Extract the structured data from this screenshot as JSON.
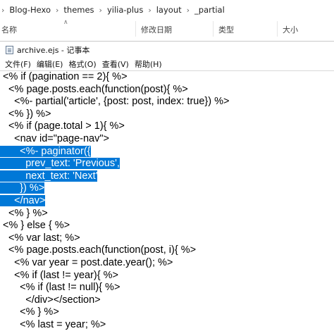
{
  "breadcrumb": {
    "items": [
      "Blog-Hexo",
      "themes",
      "yilia-plus",
      "layout",
      "_partial"
    ]
  },
  "columns": {
    "name": "名称",
    "modified": "修改日期",
    "type": "类型",
    "size": "大小"
  },
  "notepad": {
    "title": "archive.ejs - 记事本",
    "menus": [
      "文件(F)",
      "编辑(E)",
      "格式(O)",
      "查看(V)",
      "帮助(H)"
    ],
    "selection_color": "#0078d7",
    "lines": [
      {
        "text": "<% if (pagination == 2){ %>"
      },
      {
        "text": "  <% page.posts.each(function(post){ %>"
      },
      {
        "text": "    <%- partial('article', {post: post, index: true}) %>"
      },
      {
        "text": "  <% }) %>"
      },
      {
        "text": "  <% if (page.total > 1){ %>"
      },
      {
        "text": "    <nav id=\"page-nav\">"
      },
      {
        "text": "      <%- paginator({",
        "selected": true
      },
      {
        "text": "        prev_text: 'Previous',",
        "selected": true
      },
      {
        "text": "        next_text: 'Next'",
        "selected": true
      },
      {
        "text": "      }) %>",
        "selected": true
      },
      {
        "text": "    </nav>",
        "selected": true
      },
      {
        "text": "  <% } %>"
      },
      {
        "text": "<% } else { %>"
      },
      {
        "text": "  <% var last; %>"
      },
      {
        "text": "  <% page.posts.each(function(post, i){ %>"
      },
      {
        "text": "    <% var year = post.date.year(); %>"
      },
      {
        "text": "    <% if (last != year){ %>"
      },
      {
        "text": "      <% if (last != null){ %>"
      },
      {
        "text": "        </div></section>"
      },
      {
        "text": "      <% } %>"
      },
      {
        "text": "      <% last = year; %>"
      }
    ]
  }
}
